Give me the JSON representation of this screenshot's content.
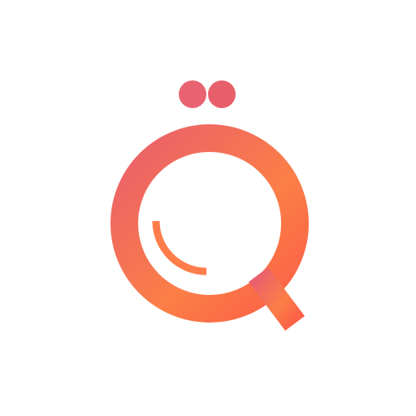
{
  "logo": {
    "icon": "magnifier-q-logo-icon",
    "colors": {
      "background": "#ffffff",
      "gradient_start": "#ea5f6c",
      "gradient_mid": "#fb7f47",
      "gradient_end": "#fb5f46",
      "dots_left": "#e96272",
      "dots_right": "#e85f6c",
      "highlight": "#ff7d4a"
    }
  }
}
